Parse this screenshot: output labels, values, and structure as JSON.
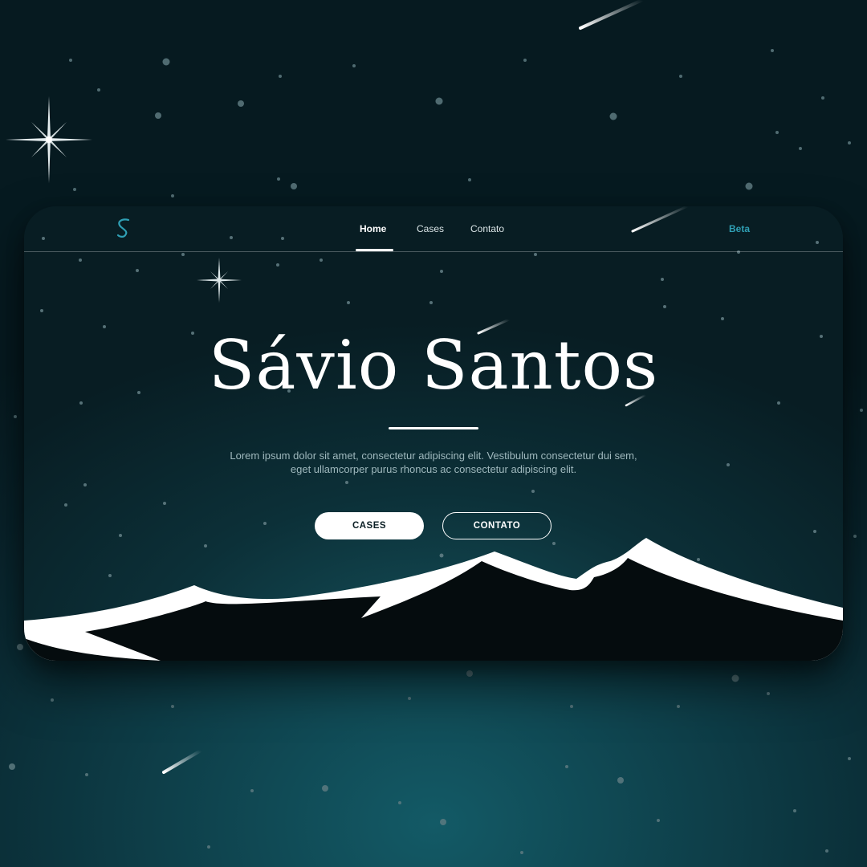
{
  "nav": {
    "logo_letter": "S",
    "links": [
      {
        "label": "Home",
        "active": true
      },
      {
        "label": "Cases",
        "active": false
      },
      {
        "label": "Contato",
        "active": false
      }
    ],
    "badge": "Beta"
  },
  "hero": {
    "title": "Sávio Santos",
    "description": "Lorem ipsum dolor sit amet, consectetur adipiscing elit. Vestibulum consectetur dui sem, eget ullamcorper purus rhoncus ac consectetur adipiscing elit.",
    "buttons": {
      "primary": "CASES",
      "secondary": "CONTATO"
    }
  },
  "colors": {
    "accent": "#2f9fb4",
    "background": "#0d3a44",
    "mountain": "#050c0e",
    "snow": "#ffffff"
  },
  "icons": [
    "logo-s-icon",
    "sparkle-star-icon",
    "shooting-star-icon"
  ]
}
